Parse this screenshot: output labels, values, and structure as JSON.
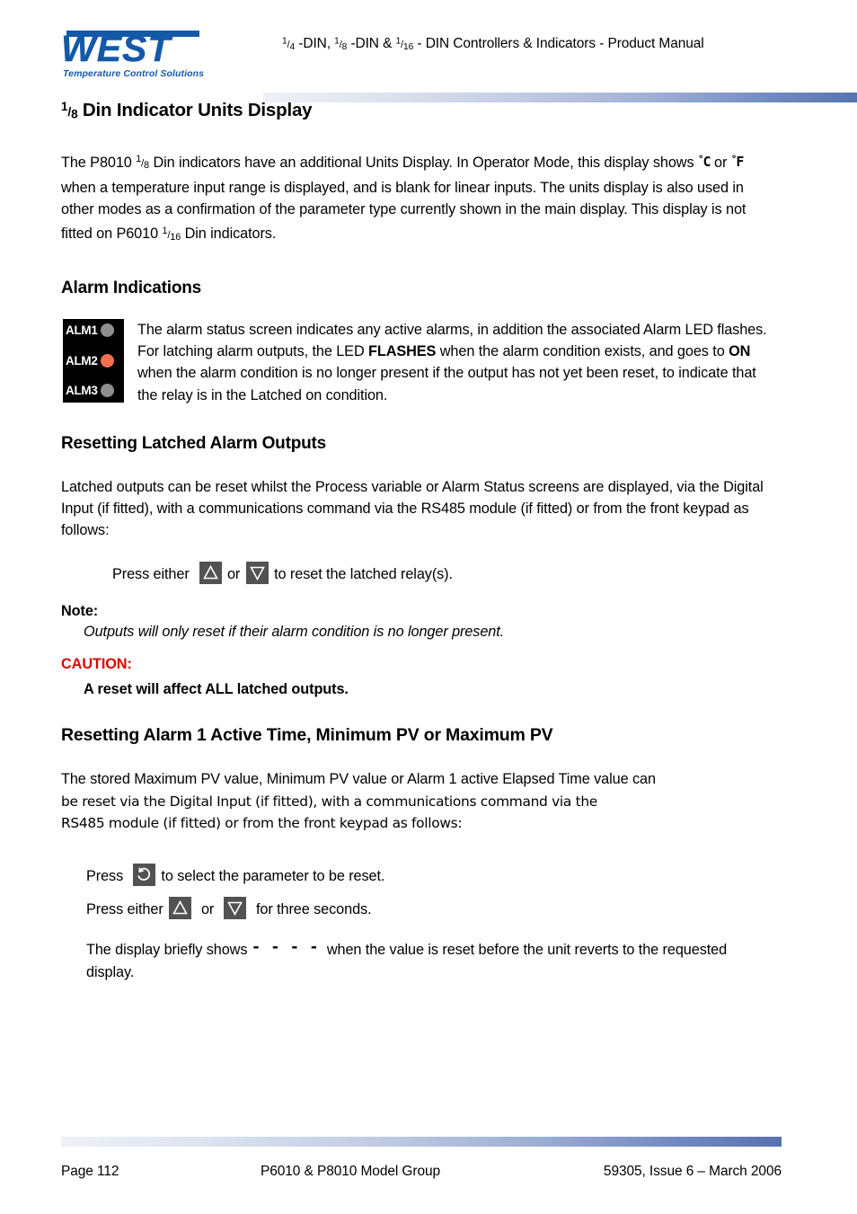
{
  "header": {
    "logo_word": "WEST",
    "logo_tagline": "Temperature Control Solutions",
    "title_parts": {
      "p1_num": "1",
      "p1_den": "4",
      "p1_tail": " -DIN, ",
      "p2_num": "1",
      "p2_den": "8",
      "p2_tail": " -DIN & ",
      "p3_num": "1",
      "p3_den": "16",
      "p3_tail": " - DIN Controllers & Indicators - Product Manual"
    },
    "title_plain": "1/4 -DIN, 1/8 -DIN & 1/16 - DIN Controllers & Indicators - Product Manual"
  },
  "sections": {
    "units_display": {
      "heading_frac_num": "1",
      "heading_frac_den": "8",
      "heading_text": " Din Indicator Units Display",
      "para_a1": "The P8010 ",
      "para_a_frac_num": "1",
      "para_a_frac_den": "8",
      "para_a2": " Din indicators have an additional Units Display. In Operator Mode, this display shows ",
      "deg_c": "°C",
      "para_a3": " or ",
      "deg_f": "°F",
      "para_a4": " when a temperature input range is displayed, and is blank for linear inputs. The units display is also used in other modes as a confirmation of the parameter type currently shown in the main display. This display is not fitted on P6010 ",
      "para_a_frac2_num": "1",
      "para_a_frac2_den": "16",
      "para_a5": " Din indicators."
    },
    "alarm_indications": {
      "heading": "Alarm Indications",
      "led_panel": {
        "row1_label": "ALM1",
        "row2_label": "ALM2",
        "row3_label": "ALM3",
        "row1_color": "#8e8e8e",
        "row2_color": "#f4714f",
        "row3_color": "#8e8e8e",
        "panel_bg": "#000000"
      },
      "para1": "The alarm status screen indicates any active alarms, in addition the associated Alarm LED flashes.",
      "para2_a": "For latching alarm outputs, the LED ",
      "para2_b": "FLASHES",
      "para2_c": " when the alarm condition exists, and goes to ",
      "para2_d": "ON",
      "para2_e": " when the alarm condition is no longer present if the output has not yet been reset, to indicate that the relay is in the Latched on condition."
    },
    "resetting_latched": {
      "heading": "Resetting Latched Alarm Outputs",
      "para": "Latched outputs can be reset whilst the Process variable or Alarm Status screens are displayed, via the Digital Input (if fitted), with a communications command via the RS485 module (if fitted) or from the front keypad as follows:",
      "instruction_pre": "Press either",
      "instruction_or": "or",
      "instruction_post": "to reset the latched relay(s).",
      "up_key_name": "up-arrow-key",
      "down_key_name": "down-arrow-key"
    },
    "note": {
      "label": "Note:",
      "body": "Outputs will only reset if their alarm condition is no longer present."
    },
    "caution": {
      "label": "CAUTION:",
      "body": "A reset will affect ALL latched outputs.",
      "color": "#e00000"
    },
    "resetting_alarm1": {
      "heading": "Resetting Alarm 1 Active Time, Minimum PV or Maximum PV",
      "para_line1": "The stored Maximum PV value, Minimum PV value or Alarm 1 active Elapsed Time value can",
      "para_line2": "be reset via the Digital Input (if fitted), with a communications command via the",
      "para_line3": "RS485 module (if fitted) or from the front keypad as follows:",
      "press_scroll_pre": "Press",
      "press_scroll_post": "to select the parameter to be reset.",
      "press_either_pre": "Press either",
      "press_either_or": "or",
      "press_either_post": "for three seconds.",
      "display_pre": "The display briefly shows",
      "display_dashes": "- - - -",
      "display_post": "when the value is reset before the unit reverts to the requested display."
    }
  },
  "footer": {
    "left": "Page 112",
    "center": "P6010 & P8010 Model Group",
    "right": "59305, Issue 6 – March 2006"
  },
  "colors": {
    "brand_blue": "#1459a8",
    "rule_gradient_end": "#5672ae",
    "key_button_bg": "#525252",
    "caution_red": "#e00000",
    "alarm_led_active": "#f4714f",
    "alarm_led_inactive": "#8e8e8e"
  }
}
